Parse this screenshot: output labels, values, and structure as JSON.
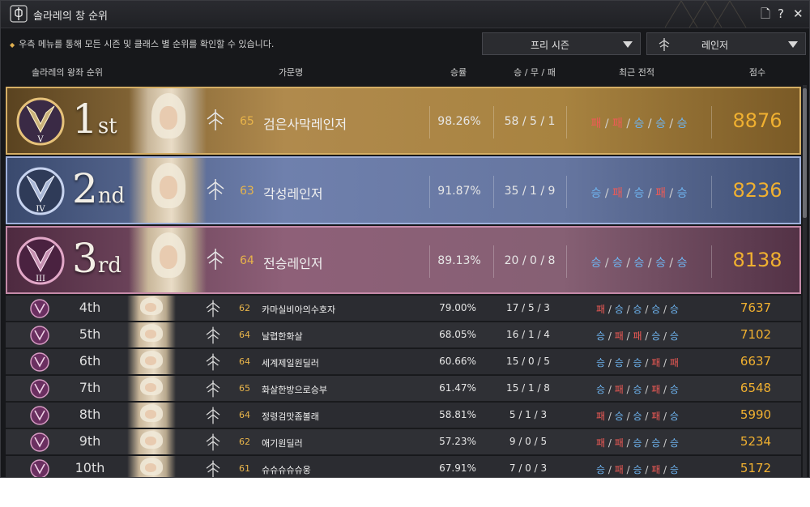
{
  "window": {
    "title": "솔라레의 창 순위",
    "buttons": {
      "doc": "🗋",
      "help": "?",
      "close": "✕"
    }
  },
  "notice": "우측 메뉴를 통해 모든 시즌 및 클래스 별 순위를 확인할 수 있습니다.",
  "filters": {
    "season": "프리 시즌",
    "class": "레인저"
  },
  "columns": {
    "rank": "솔라레의 왕좌 순위",
    "family": "가문명",
    "winrate": "승률",
    "record": "승 / 무 / 패",
    "recent": "최근 전적",
    "score": "점수"
  },
  "top_rows": [
    {
      "rank_num": "1",
      "rank_suffix": "st",
      "tier": "V",
      "level": "65",
      "name": "검은사막레인저",
      "winrate": "98.26%",
      "record": "58 / 5 / 1",
      "recent": [
        "패",
        "패",
        "승",
        "승",
        "승"
      ],
      "score": "8876"
    },
    {
      "rank_num": "2",
      "rank_suffix": "nd",
      "tier": "IV",
      "level": "63",
      "name": "각성레인저",
      "winrate": "91.87%",
      "record": "35 / 1 / 9",
      "recent": [
        "승",
        "패",
        "승",
        "패",
        "승"
      ],
      "score": "8236"
    },
    {
      "rank_num": "3",
      "rank_suffix": "rd",
      "tier": "III",
      "level": "64",
      "name": "전승레인저",
      "winrate": "89.13%",
      "record": "20 / 0 / 8",
      "recent": [
        "승",
        "승",
        "승",
        "승",
        "승"
      ],
      "score": "8138"
    }
  ],
  "rows": [
    {
      "rank": "4th",
      "level": "62",
      "name": "카마실비아의수호자",
      "winrate": "79.00%",
      "record": "17 / 5 / 3",
      "recent": [
        "패",
        "승",
        "승",
        "승",
        "승"
      ],
      "score": "7637"
    },
    {
      "rank": "5th",
      "level": "64",
      "name": "날렵한화살",
      "winrate": "68.05%",
      "record": "16 / 1 / 4",
      "recent": [
        "승",
        "패",
        "패",
        "승",
        "승"
      ],
      "score": "7102"
    },
    {
      "rank": "6th",
      "level": "64",
      "name": "세계제일원딜러",
      "winrate": "60.66%",
      "record": "15 / 0 / 5",
      "recent": [
        "승",
        "승",
        "승",
        "패",
        "패"
      ],
      "score": "6637"
    },
    {
      "rank": "7th",
      "level": "65",
      "name": "화살한방으로승부",
      "winrate": "61.47%",
      "record": "15 / 1 / 8",
      "recent": [
        "승",
        "패",
        "승",
        "패",
        "승"
      ],
      "score": "6548"
    },
    {
      "rank": "8th",
      "level": "64",
      "name": "정령검맛좀볼래",
      "winrate": "58.81%",
      "record": "5 / 1 / 3",
      "recent": [
        "패",
        "승",
        "승",
        "패",
        "승"
      ],
      "score": "5990"
    },
    {
      "rank": "9th",
      "level": "62",
      "name": "애기원딜러",
      "winrate": "57.23%",
      "record": "9 / 0 / 5",
      "recent": [
        "패",
        "패",
        "승",
        "승",
        "승"
      ],
      "score": "5234"
    },
    {
      "rank": "10th",
      "level": "61",
      "name": "슈슈슈슈슈웅",
      "winrate": "67.91%",
      "record": "7 / 0 / 3",
      "recent": [
        "승",
        "패",
        "승",
        "패",
        "승"
      ],
      "score": "5172"
    }
  ],
  "colors": {
    "win": "#6eb4f0",
    "lose": "#ef5a55",
    "score": "#f0b030",
    "level": "#e8b44a"
  }
}
